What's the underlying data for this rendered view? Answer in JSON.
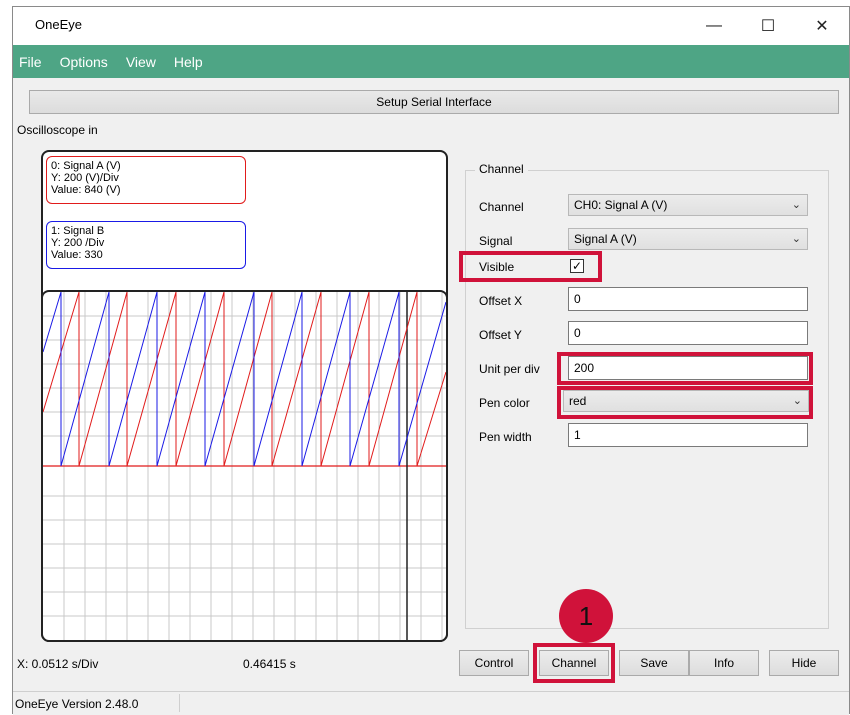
{
  "window": {
    "title": "OneEye",
    "minimize": "—",
    "maximize": "☐",
    "close": "✕"
  },
  "menu": [
    "File",
    "Options",
    "View",
    "Help"
  ],
  "setup_button": "Setup Serial Interface",
  "scope": {
    "label": "Oscilloscope in",
    "signals": [
      {
        "line1": "0: Signal A (V)",
        "line2": "Y: 200 (V)/Div",
        "line3": "Value: 840 (V)",
        "color": "#e11b1b"
      },
      {
        "line1": "1: Signal B",
        "line2": "Y: 200 /Div",
        "line3": "Value: 330",
        "color": "#1a1ae6"
      }
    ]
  },
  "channel_panel": {
    "title": "Channel",
    "channel_label": "Channel",
    "channel_value": "CH0: Signal A (V)",
    "signal_label": "Signal",
    "signal_value": "Signal A (V)",
    "visible_label": "Visible",
    "visible_checked": true,
    "offsetx_label": "Offset X",
    "offsetx_value": "0",
    "offsety_label": "Offset Y",
    "offsety_value": "0",
    "unit_label": "Unit per div",
    "unit_value": "200",
    "pen_color_label": "Pen color",
    "pen_color_value": "red",
    "pen_width_label": "Pen width",
    "pen_width_value": "1"
  },
  "bottom": {
    "xdiv": "X: 0.0512 s/Div",
    "time": "0.46415 s",
    "buttons": [
      "Control",
      "Channel",
      "Save",
      "Info",
      "Hide"
    ]
  },
  "status": "OneEye Version 2.48.0",
  "annotation_badge": "1",
  "highlight_color": "#d0123a"
}
